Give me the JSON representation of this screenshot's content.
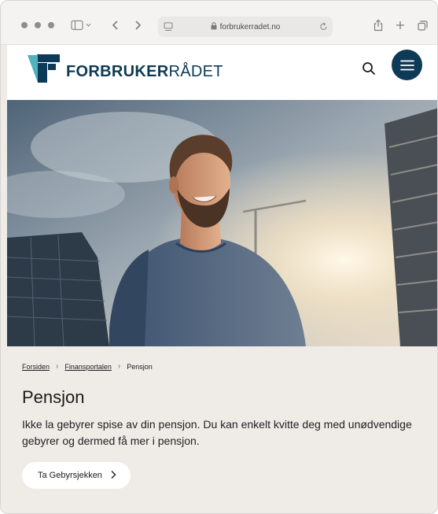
{
  "browser": {
    "url": "forbrukerradet.no"
  },
  "header": {
    "logo_bold": "FORBRUKER",
    "logo_light": "RÅDET",
    "brand_color": "#0d3a56",
    "accent_color": "#4fb3bf"
  },
  "breadcrumb": {
    "items": [
      "Forsiden",
      "Finansportalen",
      "Pensjon"
    ]
  },
  "main": {
    "title": "Pensjon",
    "intro": "Ikke la gebyrer spise av din pensjon. Du kan enkelt kvitte deg med unødvendige gebyrer og dermed få mer i pensjon.",
    "cta_label": "Ta Gebyrsjekken"
  },
  "icons": {
    "toolbar": [
      "sidebar-icon",
      "back-icon",
      "forward-icon",
      "tab-icon",
      "lock-icon",
      "reload-icon",
      "share-icon",
      "new-tab-icon",
      "tabs-overview-icon"
    ],
    "header": [
      "search-icon",
      "menu-icon"
    ]
  }
}
